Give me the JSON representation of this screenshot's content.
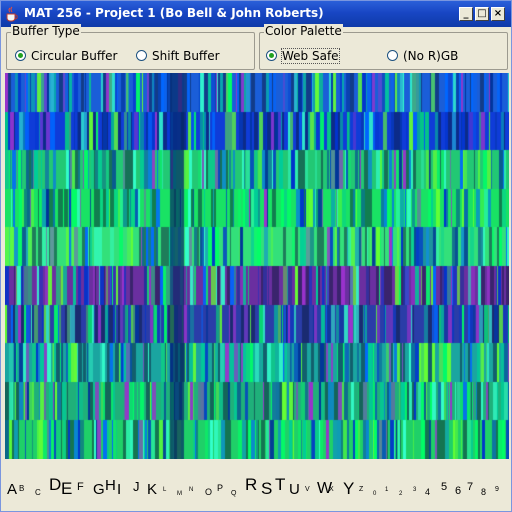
{
  "window": {
    "title": "MAT 256 - Project 1 (Bo Bell & John Roberts)",
    "controls": {
      "minimize": "_",
      "maximize": "□",
      "close": "×"
    }
  },
  "buffer_type": {
    "legend": "Buffer Type",
    "options": [
      {
        "label": "Circular Buffer",
        "selected": true
      },
      {
        "label": "Shift Buffer",
        "selected": false
      }
    ]
  },
  "color_palette": {
    "legend": "Color Palette",
    "options": [
      {
        "label": "Web Safe",
        "selected": true
      },
      {
        "label": "(No R)GB",
        "selected": false
      }
    ]
  },
  "visualization": {
    "bands": [
      "#1a5ed8",
      "#0f3cd8",
      "#22c874",
      "#19e264",
      "#33e07a",
      "#6a2fa0",
      "#2a3da8",
      "#1aa5a0",
      "#1fb07a",
      "#1fd068"
    ],
    "accent_colors": [
      "#00ff66",
      "#0033cc",
      "#33ffcc",
      "#003399",
      "#66ff33",
      "#9933cc",
      "#00cc99",
      "#0066ff"
    ]
  },
  "strip_chars": [
    "A",
    "B",
    "C",
    "D",
    "E",
    "F",
    "G",
    "H",
    "I",
    "J",
    "K",
    "L",
    "M",
    "N",
    "O",
    "P",
    "Q",
    "R",
    "S",
    "T",
    "U",
    "V",
    "W",
    "X",
    "Y",
    "Z",
    "0",
    "1",
    "2",
    "3",
    "4",
    "5",
    "6",
    "7",
    "8",
    "9"
  ]
}
